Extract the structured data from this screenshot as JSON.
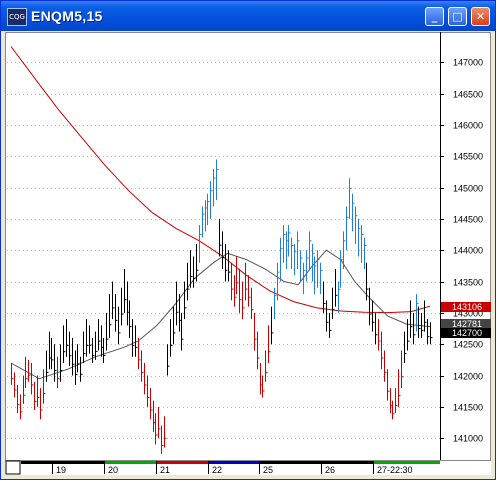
{
  "window": {
    "title": "ENQM5,15",
    "icon": "cqg-app-icon",
    "controls": [
      "minimize",
      "maximize",
      "close"
    ]
  },
  "chart_data": {
    "type": "bar",
    "title": "",
    "price_ticks": [
      "147000",
      "146500",
      "146000",
      "145500",
      "145000",
      "144500",
      "144000",
      "143500",
      "143000",
      "142500",
      "142000",
      "141500",
      "141000"
    ],
    "time_labels": [
      "19",
      "20",
      "21",
      "22",
      "25",
      "26",
      "27-22:30"
    ],
    "time_segment_colors": [
      "#000000",
      "#00aa00",
      "#cc0000",
      "#0000cc",
      "#000000",
      "#000000",
      "#00aa00"
    ],
    "last_value_tags": [
      {
        "label": "143106",
        "bg": "#cc0000"
      },
      {
        "label": "142781",
        "bg": "#444444"
      },
      {
        "label": "142700",
        "bg": "#000000"
      }
    ],
    "ylim": [
      140700,
      147450
    ],
    "bar_colors": {
      "up": "#1f7fe0",
      "down": "#cc0000",
      "neutral": "#000000"
    },
    "series": [
      {
        "name": "price",
        "type": "hlc_bars",
        "bars": [
          [
            142200,
            141850,
            "down"
          ],
          [
            142050,
            141650,
            "down"
          ],
          [
            141850,
            141400,
            "down"
          ],
          [
            141700,
            141300,
            "down"
          ],
          [
            142000,
            141550,
            "down"
          ],
          [
            142300,
            141800,
            "down"
          ],
          [
            142250,
            141900,
            "down"
          ],
          [
            142200,
            141700,
            "down"
          ],
          [
            141900,
            141450,
            "down"
          ],
          [
            142000,
            141500,
            "down"
          ],
          [
            141800,
            141300,
            "down"
          ],
          [
            142100,
            141550,
            "down"
          ],
          [
            142400,
            141900,
            "neutral"
          ],
          [
            142700,
            142100,
            "neutral"
          ],
          [
            142600,
            142100,
            "neutral"
          ],
          [
            142500,
            141900,
            "neutral"
          ],
          [
            142300,
            141800,
            "down"
          ],
          [
            142500,
            141900,
            "neutral"
          ],
          [
            142800,
            142200,
            "neutral"
          ],
          [
            142900,
            142300,
            "neutral"
          ],
          [
            142700,
            142150,
            "neutral"
          ],
          [
            142600,
            142000,
            "neutral"
          ],
          [
            142400,
            141850,
            "neutral"
          ],
          [
            142500,
            142050,
            "neutral"
          ],
          [
            142300,
            141900,
            "neutral"
          ],
          [
            142700,
            142200,
            "neutral"
          ],
          [
            142900,
            142300,
            "neutral"
          ],
          [
            142800,
            142350,
            "neutral"
          ],
          [
            142600,
            142200,
            "neutral"
          ],
          [
            142700,
            142250,
            "neutral"
          ],
          [
            142900,
            142400,
            "neutral"
          ],
          [
            142800,
            142300,
            "neutral"
          ],
          [
            142600,
            142200,
            "neutral"
          ],
          [
            143000,
            142400,
            "neutral"
          ],
          [
            143300,
            142600,
            "neutral"
          ],
          [
            143500,
            142900,
            "neutral"
          ],
          [
            143300,
            142700,
            "neutral"
          ],
          [
            143100,
            142500,
            "neutral"
          ],
          [
            143400,
            142800,
            "neutral"
          ],
          [
            143700,
            143000,
            "neutral"
          ],
          [
            143500,
            142800,
            "neutral"
          ],
          [
            143200,
            142600,
            "neutral"
          ],
          [
            142900,
            142300,
            "neutral"
          ],
          [
            142800,
            142300,
            "neutral"
          ],
          [
            142600,
            142100,
            "down"
          ],
          [
            142400,
            141900,
            "down"
          ],
          [
            142200,
            141700,
            "down"
          ],
          [
            142000,
            141500,
            "down"
          ],
          [
            141800,
            141300,
            "down"
          ],
          [
            141600,
            141100,
            "down"
          ],
          [
            141400,
            140900,
            "down"
          ],
          [
            141500,
            141000,
            "down"
          ],
          [
            141200,
            140750,
            "down"
          ],
          [
            141350,
            140850,
            "down"
          ],
          [
            142500,
            142000,
            "neutral"
          ],
          [
            142900,
            142300,
            "neutral"
          ],
          [
            143100,
            142500,
            "neutral"
          ],
          [
            143500,
            142800,
            "neutral"
          ],
          [
            143300,
            142700,
            "neutral"
          ],
          [
            143000,
            142400,
            "neutral"
          ],
          [
            143500,
            142900,
            "neutral"
          ],
          [
            143800,
            143200,
            "neutral"
          ],
          [
            144000,
            143400,
            "neutral"
          ],
          [
            143900,
            143400,
            "neutral"
          ],
          [
            144100,
            143500,
            "neutral"
          ],
          [
            144400,
            143800,
            "up"
          ],
          [
            144700,
            144200,
            "up"
          ],
          [
            144800,
            144300,
            "up"
          ],
          [
            144900,
            144400,
            "up"
          ],
          [
            145100,
            144500,
            "up"
          ],
          [
            145300,
            144700,
            "up"
          ],
          [
            145450,
            144800,
            "up"
          ],
          [
            144500,
            143900,
            "neutral"
          ],
          [
            144300,
            143700,
            "neutral"
          ],
          [
            144100,
            143500,
            "neutral"
          ],
          [
            144000,
            143500,
            "neutral"
          ],
          [
            143800,
            143200,
            "down"
          ],
          [
            143600,
            143100,
            "down"
          ],
          [
            143900,
            143300,
            "down"
          ],
          [
            143700,
            143000,
            "down"
          ],
          [
            143500,
            142900,
            "down"
          ],
          [
            143800,
            143200,
            "down"
          ],
          [
            143600,
            143100,
            "down"
          ],
          [
            143400,
            142900,
            "down"
          ],
          [
            143000,
            142400,
            "down"
          ],
          [
            142700,
            142100,
            "down"
          ],
          [
            142200,
            141700,
            "down"
          ],
          [
            142000,
            141650,
            "down"
          ],
          [
            142400,
            141900,
            "down"
          ],
          [
            142800,
            142200,
            "down"
          ],
          [
            143100,
            142500,
            "neutral"
          ],
          [
            143400,
            142900,
            "up"
          ],
          [
            143800,
            143200,
            "up"
          ],
          [
            144200,
            143500,
            "up"
          ],
          [
            144400,
            143800,
            "up"
          ],
          [
            144300,
            143700,
            "up"
          ],
          [
            144400,
            143900,
            "up"
          ],
          [
            144200,
            143700,
            "up"
          ],
          [
            144100,
            143600,
            "up"
          ],
          [
            144300,
            143700,
            "up"
          ],
          [
            144000,
            143500,
            "up"
          ],
          [
            143800,
            143300,
            "up"
          ],
          [
            144000,
            143500,
            "up"
          ],
          [
            144300,
            143700,
            "up"
          ],
          [
            144100,
            143500,
            "up"
          ],
          [
            143900,
            143300,
            "up"
          ],
          [
            144000,
            143400,
            "up"
          ],
          [
            143800,
            143300,
            "up"
          ],
          [
            143500,
            143000,
            "neutral"
          ],
          [
            143200,
            142700,
            "neutral"
          ],
          [
            143000,
            142600,
            "neutral"
          ],
          [
            143400,
            142900,
            "neutral"
          ],
          [
            143700,
            143100,
            "neutral"
          ],
          [
            143500,
            143000,
            "up"
          ],
          [
            144000,
            143400,
            "up"
          ],
          [
            144300,
            143700,
            "up"
          ],
          [
            144700,
            144000,
            "up"
          ],
          [
            145150,
            144500,
            "up"
          ],
          [
            144900,
            144300,
            "up"
          ],
          [
            144700,
            144100,
            "up"
          ],
          [
            144500,
            143900,
            "up"
          ],
          [
            144400,
            143800,
            "up"
          ],
          [
            144200,
            143700,
            "up"
          ],
          [
            143800,
            143200,
            "neutral"
          ],
          [
            143400,
            142800,
            "neutral"
          ],
          [
            143200,
            142700,
            "neutral"
          ],
          [
            143000,
            142500,
            "neutral"
          ],
          [
            142900,
            142400,
            "down"
          ],
          [
            142700,
            142100,
            "down"
          ],
          [
            142400,
            141900,
            "down"
          ],
          [
            142100,
            141600,
            "down"
          ],
          [
            141800,
            141400,
            "down"
          ],
          [
            141600,
            141300,
            "down"
          ],
          [
            141800,
            141400,
            "down"
          ],
          [
            142100,
            141500,
            "down"
          ],
          [
            142400,
            141800,
            "down"
          ],
          [
            142700,
            142200,
            "neutral"
          ],
          [
            142900,
            142400,
            "neutral"
          ],
          [
            143200,
            142600,
            "neutral"
          ],
          [
            143000,
            142500,
            "neutral"
          ],
          [
            143300,
            142700,
            "up"
          ],
          [
            143100,
            142600,
            "neutral"
          ],
          [
            143000,
            142600,
            "neutral"
          ],
          [
            143200,
            142700,
            "neutral"
          ],
          [
            142900,
            142500,
            "neutral"
          ],
          [
            142850,
            142500,
            "neutral"
          ]
        ]
      },
      {
        "name": "ma_long",
        "color": "#cc0000",
        "points": [
          [
            0,
            147250
          ],
          [
            10,
            146750
          ],
          [
            20,
            146250
          ],
          [
            30,
            145800
          ],
          [
            40,
            145350
          ],
          [
            50,
            144950
          ],
          [
            60,
            144600
          ],
          [
            70,
            144350
          ],
          [
            80,
            144150
          ],
          [
            90,
            143900
          ],
          [
            100,
            143600
          ],
          [
            110,
            143350
          ],
          [
            120,
            143180
          ],
          [
            130,
            143080
          ],
          [
            140,
            143030
          ],
          [
            150,
            143010
          ],
          [
            160,
            143005
          ],
          [
            170,
            143020
          ],
          [
            178,
            143106
          ]
        ]
      },
      {
        "name": "ma_short",
        "color": "#555555",
        "points": [
          [
            0,
            142200
          ],
          [
            12,
            141950
          ],
          [
            24,
            142100
          ],
          [
            36,
            142300
          ],
          [
            48,
            142450
          ],
          [
            54,
            142550
          ],
          [
            62,
            142800
          ],
          [
            70,
            143150
          ],
          [
            78,
            143550
          ],
          [
            86,
            143800
          ],
          [
            92,
            143950
          ],
          [
            100,
            143850
          ],
          [
            108,
            143700
          ],
          [
            116,
            143500
          ],
          [
            122,
            143450
          ],
          [
            128,
            143750
          ],
          [
            134,
            144000
          ],
          [
            140,
            143850
          ],
          [
            146,
            143500
          ],
          [
            152,
            143250
          ],
          [
            160,
            142950
          ],
          [
            168,
            142820
          ],
          [
            178,
            142781
          ]
        ]
      }
    ]
  }
}
